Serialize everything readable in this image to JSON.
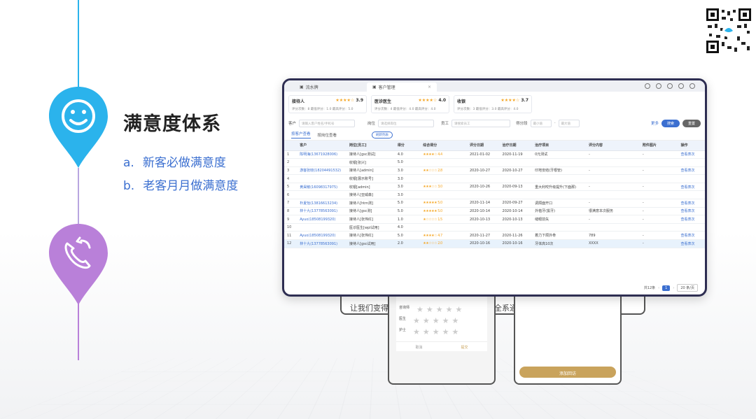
{
  "slide": {
    "title": "满意度体系",
    "bullets": [
      {
        "marker": "a.",
        "text": "新客必做满意度"
      },
      {
        "marker": "b.",
        "text": "老客月月做满意度"
      }
    ],
    "colors": {
      "pin_top": "#2bb3ec",
      "pin_bottom": "#b980d9",
      "accent": "#3b6fd0"
    }
  },
  "icons": {
    "pin_top": "smiley-icon",
    "pin_bottom": "phone-callback-icon",
    "qr": "qr-code-icon"
  },
  "window": {
    "tabs": [
      "流水牌",
      "客户管理"
    ],
    "cards": [
      {
        "name": "接待人",
        "score": "3.9",
        "sub": "评分次数：8  最低评分：1.0  最高评分：5.0"
      },
      {
        "name": "医诊医生",
        "score": "4.0",
        "sub": "评分次数：4  最低评分：4.0  最高评分：4.0"
      },
      {
        "name": "收银",
        "score": "3.7",
        "sub": "评分次数：3  最低评分：3.0  最高评分：4.0"
      }
    ],
    "filters": {
      "customer_label": "客户",
      "customer_placeholder": "请输入客户姓名/手机号",
      "position_label": "岗位",
      "position_placeholder": "请选择岗位",
      "staff_label": "员工",
      "staff_placeholder": "请搜索员工",
      "score_label": "得分段",
      "min_placeholder": "最小值",
      "max_placeholder": "最大值",
      "more": "更多",
      "search_btn": "搜索",
      "reset_btn": "重置"
    },
    "subtabs": {
      "by_customer": "按客户查看",
      "by_position": "按岗位查看",
      "refresh": "刷新列表"
    },
    "table": {
      "headers": [
        "",
        "客户",
        "岗位[员工]",
        "得分",
        "综合得分",
        "评分日期",
        "治疗日期",
        "治疗项目",
        "评分内容",
        "附件图片",
        "操作"
      ],
      "rows": [
        [
          "1",
          "陈明海(13671928006)",
          "接待人[gsc测试]",
          "4.0",
          "★★★★☆ 4.4",
          "2021-01-02",
          "2020-11-19",
          "0元测试",
          "-",
          "-",
          "查看表次"
        ],
        [
          "2",
          "",
          "收银[张兴]",
          "5.0",
          "",
          "",
          "",
          "",
          "",
          "",
          ""
        ],
        [
          "3",
          "游客张晓(18204491532)",
          "接待人[admin]",
          "3.0",
          "★★☆☆☆ 2.8",
          "2020-10-27",
          "2020-10-27",
          "印地安结(牙根管)",
          "-",
          "-",
          "查看表次"
        ],
        [
          "4",
          "",
          "收银[展示账号]",
          "3.0",
          "",
          "",
          "",
          "",
          "",
          "",
          ""
        ],
        [
          "5",
          "黄昊敏(16098317975)",
          "收银[admin]",
          "3.0",
          "★★★☆☆ 3.0",
          "2020-10-26",
          "2020-09-13",
          "重大利咬升级提升(下面那)",
          "-",
          "-",
          "查看表次"
        ],
        [
          "6",
          "",
          "接待人[亚威森]",
          "3.0",
          "",
          "",
          "",
          "",
          "",
          "",
          ""
        ],
        [
          "7",
          "朴夏怡(13816613234)",
          "接待人[htm测]",
          "5.0",
          "★★★★★ 5.0",
          "2020-11-14",
          "2020-09-27",
          "调颌面开口",
          "-",
          "-",
          "查看表次"
        ],
        [
          "8",
          "林十九(13778563091)",
          "接待人[gsc测]",
          "5.0",
          "★★★★★ 5.0",
          "2020-10-14",
          "2020-10-14",
          "外植牙(拔牙)",
          "很满意本次服务",
          "-",
          "查看表次"
        ],
        [
          "9",
          "Ayuo(18508199320)",
          "接待人[张伟红]",
          "1.0",
          "★☆☆☆☆ 1.5",
          "2020-10-13",
          "2020-10-13",
          "缝眼前矢",
          "-",
          "-",
          "查看表次"
        ],
        [
          "10",
          "",
          "医诊医生[wpl试用]",
          "4.0",
          "",
          "",
          "",
          "",
          "",
          "",
          ""
        ],
        [
          "11",
          "Ayuo(18508199320)",
          "接待人[张伟红]",
          "5.0",
          "★★★★☆ 4.7",
          "2020-11-27",
          "2020-11-26",
          "着力下颌外骨",
          "789",
          "-",
          "查看表次"
        ],
        [
          "12",
          "林十九(13778563091)",
          "接待人[gsc试用]",
          "2.0",
          "★★☆☆☆ 2.0",
          "2020-10-16",
          "2020-10-16",
          "牙体高10次",
          "XXXX",
          "-",
          "查看表次"
        ]
      ],
      "selected_row": 11
    },
    "footer": {
      "total": "共12条",
      "page": "1",
      "page_size": "20 条/页"
    }
  },
  "behind": {
    "left_text": "让我们变得",
    "right_text": "全系通",
    "rating_rows": [
      "咨询师",
      "医生",
      "护士"
    ],
    "cancel": "取消",
    "submit": "提交",
    "add_btn": "添加回访"
  }
}
